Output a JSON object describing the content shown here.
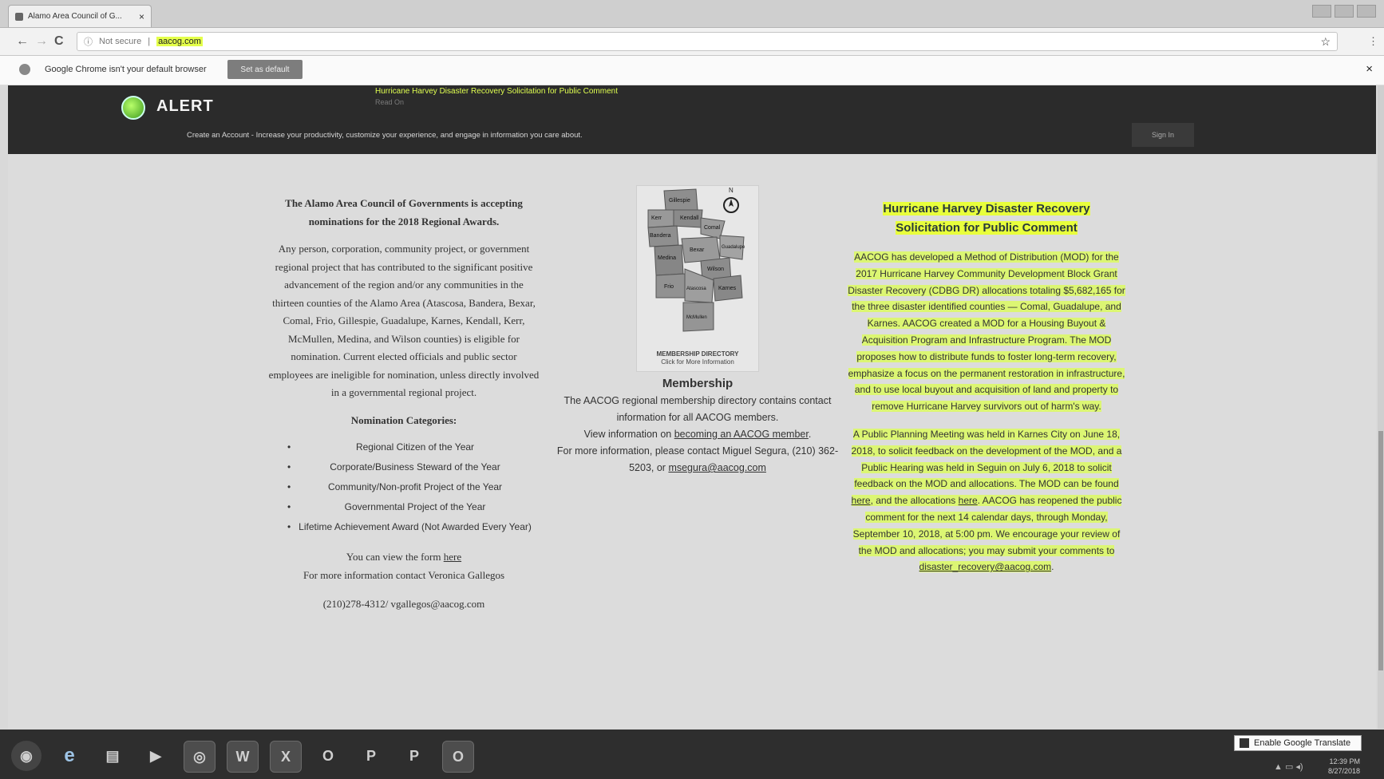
{
  "browser": {
    "tab_title": "Alamo Area Council of G...",
    "tab_close": "×",
    "back": "←",
    "forward": "→",
    "reload": "C",
    "not_secure": "Not secure",
    "url": "aacog.com",
    "bookmark_star": "☆",
    "menu": "⋮",
    "infobar_message": "Google Chrome isn't your default browser",
    "infobar_button": "Set as default",
    "infobar_close": "×"
  },
  "header": {
    "alert_label": "ALERT",
    "ticker": "Hurricane Harvey Disaster Recovery Solicitation for Public Comment",
    "ticker_sub": "Read On",
    "account_message": "Create an Account - Increase your productivity, customize your experience, and engage in information you care about.",
    "signin": "Sign In"
  },
  "awards": {
    "intro": "The Alamo Area Council of Governments is accepting nominations for the 2018 Regional Awards.",
    "body": "Any person, corporation, community project, or government regional project that has contributed to the significant positive advancement of the region and/or any communities in the thirteen counties of the Alamo Area (Atascosa, Bandera, Bexar, Comal, Frio, Gillespie, Guadalupe, Karnes, Kendall, Kerr, McMullen, Medina, and Wilson counties) is eligible for nomination.  Current elected officials and public sector employees are ineligible for nomination, unless directly involved in a governmental regional project.",
    "categories_heading": "Nomination Categories:",
    "categories": [
      "Regional Citizen of the Year",
      "Corporate/Business Steward of the Year",
      "Community/Non-profit Project of the Year",
      "Governmental Project of the Year",
      "Lifetime Achievement Award (Not Awarded Every Year)"
    ],
    "form_prefix": "You can view the form ",
    "form_link": "here",
    "contact": "For more information contact Veronica Gallegos",
    "contact_details": "(210)278-4312/ vgallegos@aacog.com"
  },
  "membership": {
    "map_caption_1": "MEMBERSHIP DIRECTORY",
    "map_caption_2": "Click for More Information",
    "map_counties": [
      "Gillespie",
      "Kerr",
      "Kendall",
      "Comal",
      "Bandera",
      "Guadalupe",
      "Medina",
      "Bexar",
      "Wilson",
      "Frio",
      "Atascosa",
      "Karnes",
      "McMullen"
    ],
    "compass": "N",
    "heading": "Membership",
    "line1": "The AACOG regional membership directory contains contact information for all AACOG members.",
    "line2_prefix": "View information on ",
    "line2_link": "becoming an AACOG member",
    "line3": "For more information, please contact Miguel Segura, (210) 362-5203, or ",
    "email": "msegura@aacog.com"
  },
  "recovery": {
    "title_1": "Hurricane Harvey Disaster Recovery",
    "title_2": "Solicitation for Public Comment",
    "para1": "AACOG has developed a Method of Distribution (MOD) for the 2017 Hurricane Harvey Community Development Block Grant Disaster Recovery (CDBG DR) allocations totaling $5,682,165 for the three disaster identified counties — Comal, Guadalupe, and Karnes.  AACOG created a MOD for a Housing Buyout & Acquisition Program and Infrastructure Program.  The MOD proposes how to distribute funds to foster long-term recovery, emphasize a focus on the permanent restoration in infrastructure, and to use local buyout and acquisition of land and property to remove Hurricane Harvey survivors out of harm's way.",
    "para2_a": "A Public Planning Meeting was held in Karnes City on June 18, 2018, to solicit feedback on the development of the MOD, and a Public Hearing was held in Seguin on July 6, 2018 to solicit feedback on the MOD and allocations. The MOD can be found ",
    "link_here_1": "here",
    "para2_b": ", and the allocations ",
    "link_here_2": "here",
    "para2_c": ". AACOG has reopened the public comment for the next 14 calendar days, through Monday, September 10, 2018, at 5:00 pm.  We encourage your review of the MOD and allocations; you may submit your comments to ",
    "email": "disaster_recovery@aacog.com",
    "para2_end": "."
  },
  "taskbar": {
    "translate": "Enable Google Translate",
    "icons": [
      "start-orb",
      "ie",
      "explorer",
      "media",
      "chrome",
      "W",
      "X",
      "O",
      "P",
      "P",
      "O"
    ],
    "time": "12:39 PM",
    "date": "8/27/2018"
  },
  "colors": {
    "highlight": "#e8ff3c",
    "alert_bar": "#2b2b2b",
    "page_bg": "#dcdcdc"
  }
}
